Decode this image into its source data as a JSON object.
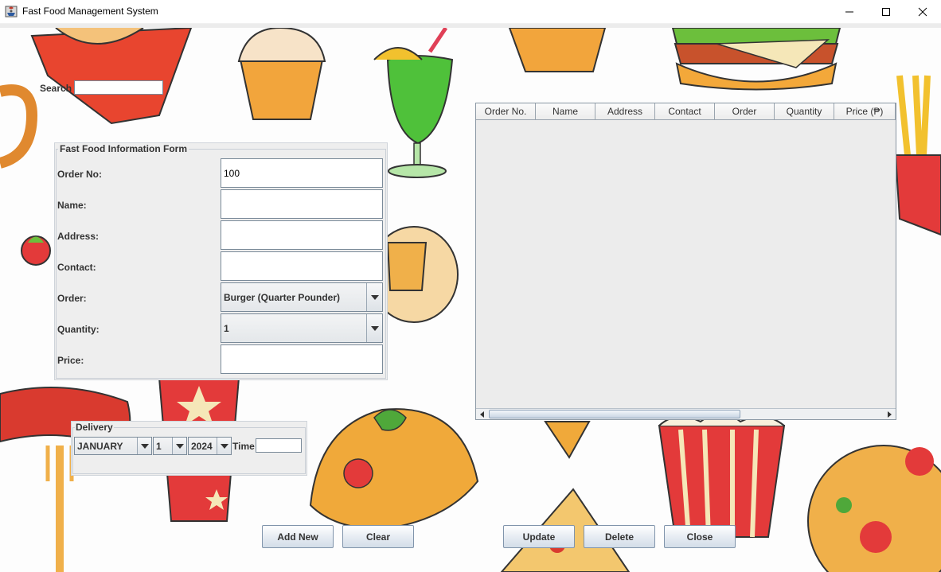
{
  "window": {
    "title": "Fast Food Management System",
    "controls": [
      "minimize-icon",
      "maximize-icon",
      "close-icon"
    ]
  },
  "search": {
    "label": "Search",
    "value": ""
  },
  "form": {
    "legend": "Fast Food Information Form",
    "fields": [
      {
        "label": "Order No:",
        "value": "100"
      },
      {
        "label": "Name:",
        "value": ""
      },
      {
        "label": "Address:",
        "value": ""
      },
      {
        "label": "Contact:",
        "value": ""
      },
      {
        "label": "Order:",
        "value": "Burger (Quarter Pounder)"
      },
      {
        "label": "Quantity:",
        "value": "1"
      },
      {
        "label": "Price:",
        "value": ""
      }
    ]
  },
  "table": {
    "columns": [
      "Order No.",
      "Name",
      "Address",
      "Contact",
      "Order",
      "Quantity",
      "Price (₱)"
    ],
    "rows": []
  },
  "delivery": {
    "legend": "Delivery",
    "month": "JANUARY",
    "day": "1",
    "year": "2024",
    "time_label": "Time",
    "time_value": ""
  },
  "buttons": {
    "add_new": "Add New",
    "clear": "Clear",
    "update": "Update",
    "delete": "Delete",
    "close": "Close"
  },
  "colors": {
    "panel": "#eeeeee",
    "border": "#7a8a99",
    "button_top": "#ffffff",
    "button_bottom": "#d3dde8"
  }
}
